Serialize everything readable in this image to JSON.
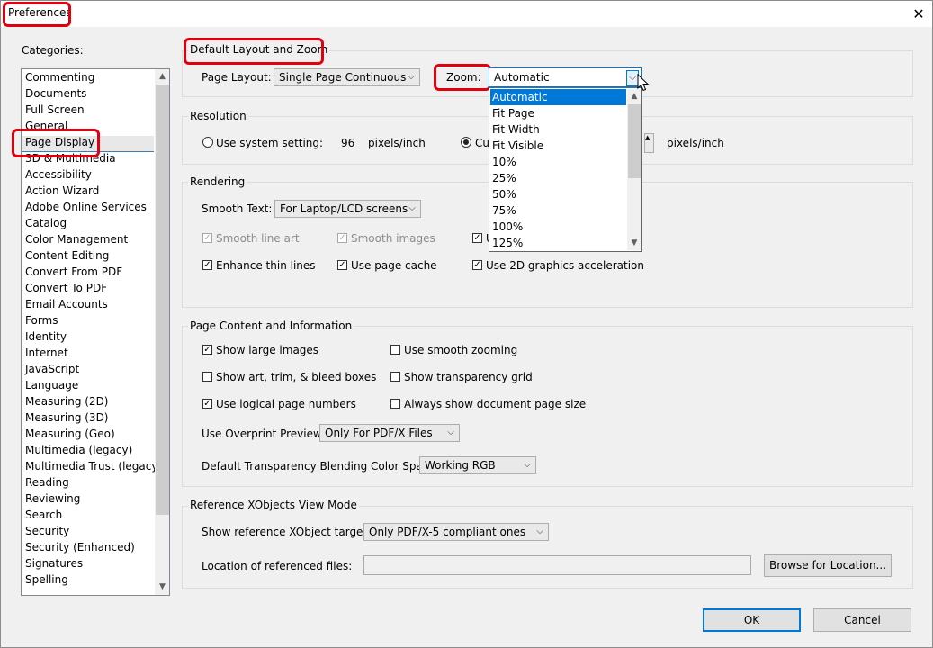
{
  "window": {
    "title": "Preferences",
    "close_glyph": "✕"
  },
  "categories": {
    "label": "Categories:",
    "items": [
      "Commenting",
      "Documents",
      "Full Screen",
      "General",
      "Page Display",
      "3D & Multimedia",
      "Accessibility",
      "Action Wizard",
      "Adobe Online Services",
      "Catalog",
      "Color Management",
      "Content Editing",
      "Convert From PDF",
      "Convert To PDF",
      "Email Accounts",
      "Forms",
      "Identity",
      "Internet",
      "JavaScript",
      "Language",
      "Measuring (2D)",
      "Measuring (3D)",
      "Measuring (Geo)",
      "Multimedia (legacy)",
      "Multimedia Trust (legacy)",
      "Reading",
      "Reviewing",
      "Search",
      "Security",
      "Security (Enhanced)",
      "Signatures",
      "Spelling"
    ],
    "selected": "Page Display"
  },
  "layout_zoom": {
    "title": "Default Layout and Zoom",
    "page_layout_label": "Page Layout:",
    "page_layout_value": "Single Page Continuous",
    "zoom_label": "Zoom:",
    "zoom_value": "Automatic",
    "zoom_options": [
      "Automatic",
      "Fit Page",
      "Fit Width",
      "Fit Visible",
      "10%",
      "25%",
      "50%",
      "75%",
      "100%",
      "125%"
    ]
  },
  "resolution": {
    "title": "Resolution",
    "system_label": "Use system setting:",
    "system_value": "96",
    "system_unit": "pixels/inch",
    "custom_label": "Cu",
    "custom_unit": "pixels/inch"
  },
  "rendering": {
    "title": "Rendering",
    "smooth_text_label": "Smooth Text:",
    "smooth_text_value": "For Laptop/LCD screens",
    "smooth_line_art": "Smooth line art",
    "smooth_images": "Smooth images",
    "third_partial": "U",
    "enhance_thin_lines": "Enhance thin lines",
    "use_page_cache": "Use page cache",
    "use_2d_accel": "Use 2D graphics acceleration"
  },
  "page_content": {
    "title": "Page Content and Information",
    "show_large_images": "Show large images",
    "use_smooth_zooming": "Use smooth zooming",
    "show_art_boxes": "Show art, trim, & bleed boxes",
    "show_transparency_grid": "Show transparency grid",
    "use_logical_page_numbers": "Use logical page numbers",
    "always_show_page_size": "Always show document page size",
    "overprint_label": "Use Overprint Preview:",
    "overprint_value": "Only For PDF/X Files",
    "blending_label": "Default Transparency Blending Color Space:",
    "blending_value": "Working RGB"
  },
  "xobjects": {
    "title": "Reference XObjects View Mode",
    "targets_label": "Show reference XObject targets:",
    "targets_value": "Only PDF/X-5 compliant ones",
    "location_label": "Location of referenced files:",
    "browse_label": "Browse for Location..."
  },
  "footer": {
    "ok_label": "OK",
    "cancel_label": "Cancel"
  },
  "icons": {
    "check": "✓",
    "chevron_down": "⌵",
    "arrow_up": "▲",
    "arrow_down": "▼"
  },
  "colors": {
    "accent": "#0078d7",
    "highlight_box": "#e00010"
  }
}
